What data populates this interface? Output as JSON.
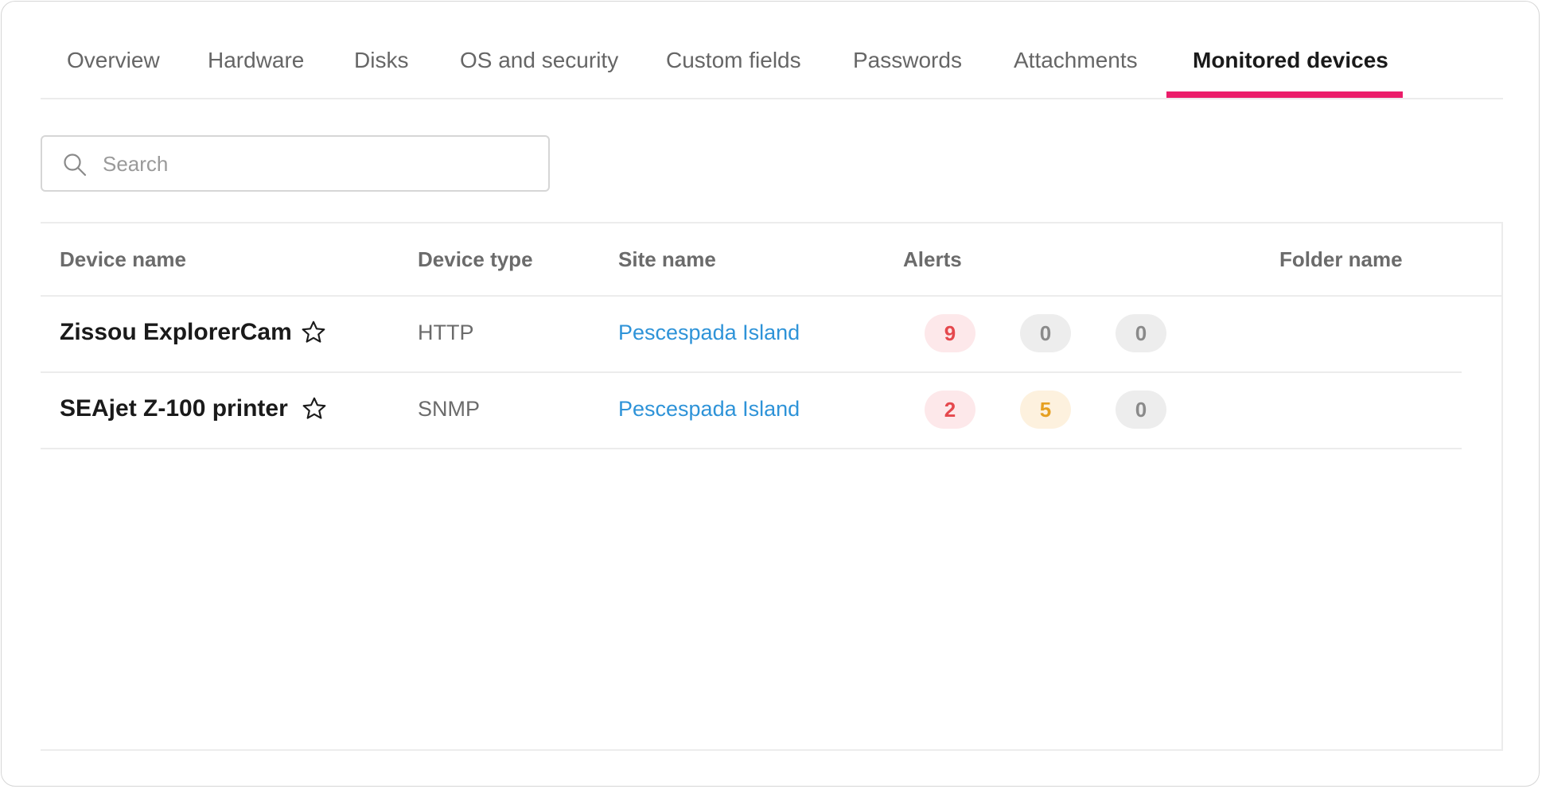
{
  "tabs": [
    {
      "label": "Overview"
    },
    {
      "label": "Hardware"
    },
    {
      "label": "Disks"
    },
    {
      "label": "OS and security"
    },
    {
      "label": "Custom fields"
    },
    {
      "label": "Passwords"
    },
    {
      "label": "Attachments"
    },
    {
      "label": "Monitored devices",
      "active": true
    }
  ],
  "colors": {
    "accent": "#eb1d6a",
    "link": "#2e93d8",
    "alert_critical": "#e5484d",
    "alert_warning": "#e6a021",
    "alert_neutral": "#8a8a8a"
  },
  "search": {
    "placeholder": "Search",
    "value": "",
    "icon": "search-icon"
  },
  "table": {
    "columns": [
      "Device name",
      "Device type",
      "Site name",
      "Alerts",
      "Folder name"
    ],
    "rows": [
      {
        "device_name": "Zissou ExplorerCam",
        "favorite_icon": "star-outline-icon",
        "device_type": "HTTP",
        "site_name": "Pescespada Island",
        "alerts": {
          "critical": "9",
          "warning": "0",
          "info": "0"
        },
        "folder_name": ""
      },
      {
        "device_name": "SEAjet Z-100 printer",
        "favorite_icon": "star-outline-icon",
        "device_type": "SNMP",
        "site_name": "Pescespada Island",
        "alerts": {
          "critical": "2",
          "warning": "5",
          "info": "0"
        },
        "folder_name": ""
      }
    ]
  }
}
